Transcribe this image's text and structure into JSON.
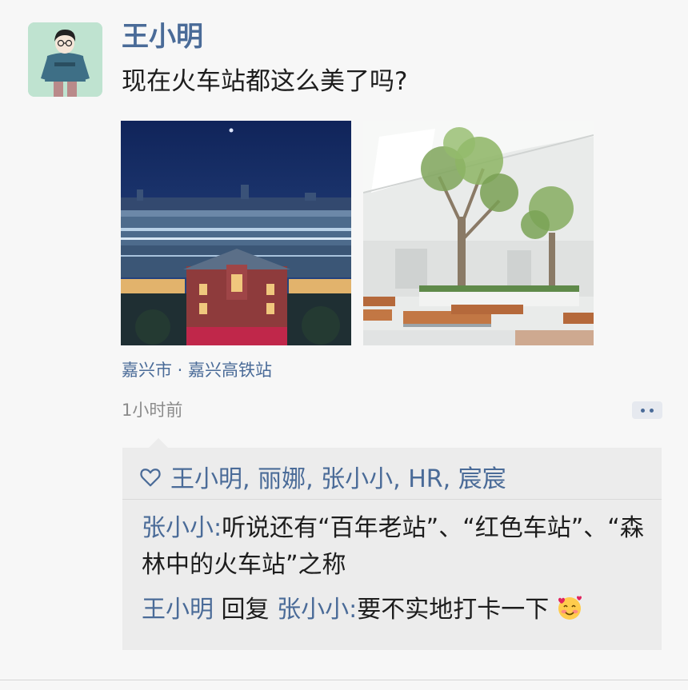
{
  "post": {
    "username": "王小明",
    "text": "现在火车站都这么美了吗?",
    "location": "嘉兴市 · 嘉兴高铁站",
    "time": "1小时前"
  },
  "likes": {
    "names": "王小明, 丽娜, 张小小, HR, 宸宸"
  },
  "comments": [
    {
      "author": "张小小",
      "separator": ":",
      "text": "听说还有“百年老站”、“红色车站”、“森林中的火车站”之称"
    },
    {
      "author": "王小明",
      "reply_word": "回复",
      "reply_to": "张小小",
      "separator": ":",
      "text": "要不实地打卡一下",
      "emoji": "smiling-face-with-hearts-icon"
    }
  ],
  "colors": {
    "accent": "#4a6b98",
    "avatar_bg": "#bfe3d0",
    "panel_bg": "#ececec",
    "page_bg": "#f7f7f7"
  }
}
